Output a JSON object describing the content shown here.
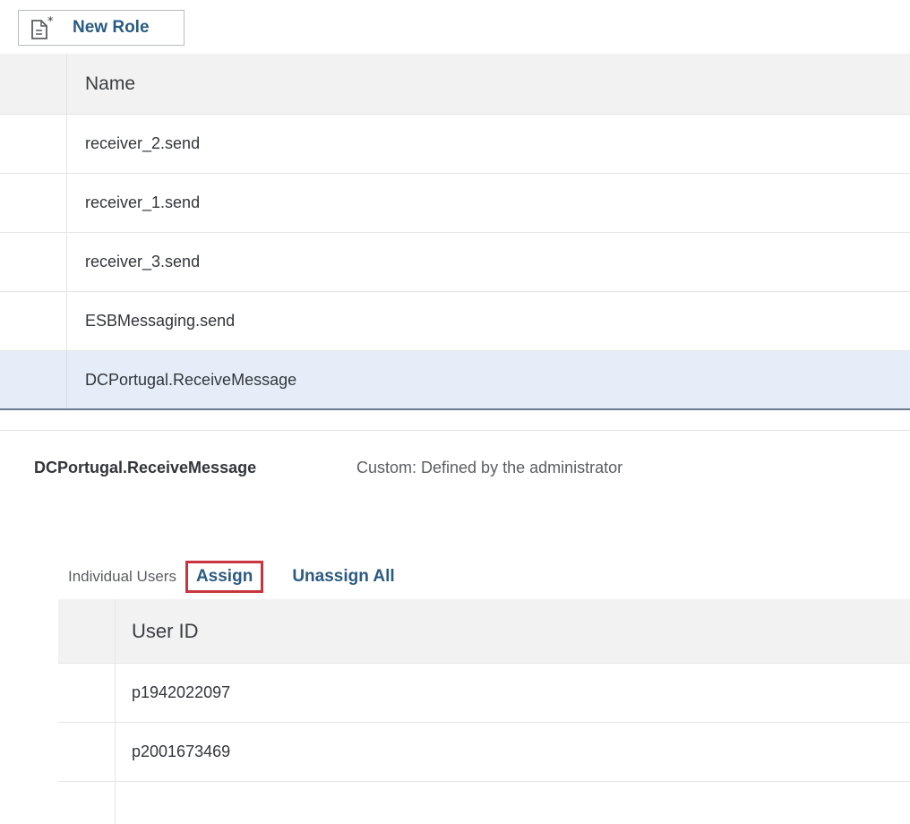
{
  "toolbar": {
    "new_role_label": "New Role",
    "new_role_icon": "new-document-icon"
  },
  "roles_table": {
    "header": "Name",
    "rows": [
      "receiver_2.send",
      "receiver_1.send",
      "receiver_3.send",
      "ESBMessaging.send",
      "DCPortugal.ReceiveMessage"
    ],
    "selected_row": "DCPortugal.ReceiveMessage"
  },
  "details": {
    "role_name": "DCPortugal.ReceiveMessage",
    "role_description": "Custom: Defined by the administrator",
    "users_section_label": "Individual Users",
    "assign_label": "Assign",
    "unassign_all_label": "Unassign All",
    "users_table": {
      "header": "User ID",
      "rows": [
        "p1942022097",
        "p2001673469"
      ]
    }
  },
  "colors": {
    "link_blue": "#2b5b82",
    "selected_row": "#e5eef8",
    "highlight_red": "#c9353e",
    "header_bg": "#f2f2f2"
  }
}
